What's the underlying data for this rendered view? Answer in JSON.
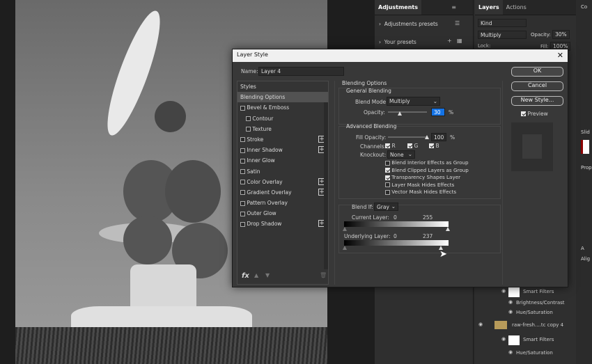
{
  "panels": {
    "adjustments_tab": "Adjustments",
    "adjustments_presets": "Adjustments presets",
    "your_presets": "Your presets",
    "layers_tab": "Layers",
    "actions_tab": "Actions",
    "kind": "Kind",
    "blend": "Multiply",
    "opacity_label": "Opacity:",
    "opacity_value": "30%",
    "lock": "Lock:",
    "fill_label": "Fill:",
    "fill_value": "100%",
    "right_col": [
      "Slid",
      "Prop",
      "A",
      "Alig"
    ],
    "layer_rows": [
      "Smart Filters",
      "Brightness/Contrast",
      "Hue/Saturation",
      "raw-fresh....tc copy 4",
      "Smart Filters",
      "Hue/Saturation"
    ]
  },
  "dialog": {
    "title": "Layer Style",
    "name_label": "Name:",
    "name_value": "Layer 4",
    "styles_header": "Styles",
    "styles": [
      {
        "label": "Blending Options",
        "checkbox": false,
        "plus": false,
        "active": true
      },
      {
        "label": "Bevel & Emboss",
        "checkbox": true,
        "plus": false
      },
      {
        "label": "Contour",
        "checkbox": true,
        "plus": false,
        "indent": true
      },
      {
        "label": "Texture",
        "checkbox": true,
        "plus": false,
        "indent": true
      },
      {
        "label": "Stroke",
        "checkbox": true,
        "plus": true
      },
      {
        "label": "Inner Shadow",
        "checkbox": true,
        "plus": true
      },
      {
        "label": "Inner Glow",
        "checkbox": true,
        "plus": false
      },
      {
        "label": "Satin",
        "checkbox": true,
        "plus": false
      },
      {
        "label": "Color Overlay",
        "checkbox": true,
        "plus": true
      },
      {
        "label": "Gradient Overlay",
        "checkbox": true,
        "plus": true
      },
      {
        "label": "Pattern Overlay",
        "checkbox": true,
        "plus": false
      },
      {
        "label": "Outer Glow",
        "checkbox": true,
        "plus": false
      },
      {
        "label": "Drop Shadow",
        "checkbox": true,
        "plus": true
      }
    ],
    "fx": "fx",
    "blending_options_title": "Blending Options",
    "general_blending": "General Blending",
    "blend_mode_label": "Blend Mode:",
    "blend_mode_value": "Multiply",
    "opacity_label": "Opacity:",
    "opacity_value": "30",
    "percent": "%",
    "advanced_blending": "Advanced Blending",
    "fill_opacity_label": "Fill Opacity:",
    "fill_opacity_value": "100",
    "channels_label": "Channels:",
    "channel_r": "R",
    "channel_g": "G",
    "channel_b": "B",
    "knockout_label": "Knockout:",
    "knockout_value": "None",
    "options": [
      {
        "label": "Blend Interior Effects as Group",
        "checked": false
      },
      {
        "label": "Blend Clipped Layers as Group",
        "checked": true
      },
      {
        "label": "Transparency Shapes Layer",
        "checked": true
      },
      {
        "label": "Layer Mask Hides Effects",
        "checked": false
      },
      {
        "label": "Vector Mask Hides Effects",
        "checked": false
      }
    ],
    "blend_if_label": "Blend If:",
    "blend_if_value": "Gray",
    "current_layer_label": "Current Layer:",
    "current_low": "0",
    "current_high": "255",
    "underlying_layer_label": "Underlying Layer:",
    "underlying_low": "0",
    "underlying_high": "237",
    "ok": "OK",
    "cancel": "Cancel",
    "new_style": "New Style...",
    "preview": "Preview",
    "levels": {
      "opacity": 0.3,
      "fill_opacity": 1.0,
      "underlying_high": 0.929
    }
  },
  "colors": {
    "accent": "#1473e6"
  }
}
